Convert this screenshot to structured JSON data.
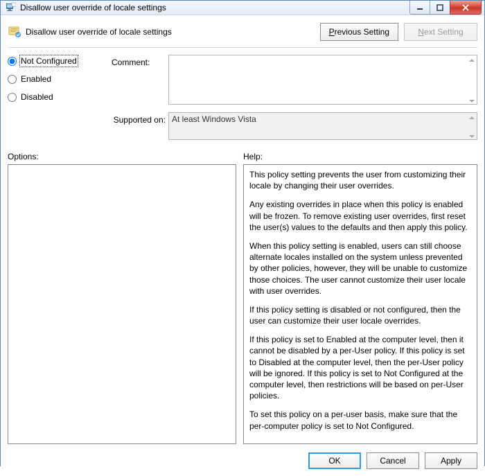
{
  "window": {
    "title": "Disallow user override of locale settings"
  },
  "subheader": {
    "title": "Disallow user override of locale settings",
    "prev_label_pre": "P",
    "prev_label_post": "revious Setting",
    "next_label_pre": "N",
    "next_label_post": "ext Setting"
  },
  "state": {
    "not_configured": "Not Configured",
    "enabled": "Enabled",
    "disabled": "Disabled",
    "selected": "not_configured"
  },
  "fields": {
    "comment_label": "Comment:",
    "comment_value": "",
    "supported_label": "Supported on:",
    "supported_value": "At least Windows Vista"
  },
  "panes": {
    "options_label": "Options:",
    "help_label": "Help:"
  },
  "help": {
    "p1": "This policy setting prevents the user from customizing their locale by changing their user overrides.",
    "p2": "Any existing overrides in place when this policy is enabled will be frozen. To remove existing user overrides, first reset the user(s) values to the defaults and then apply this policy.",
    "p3": "When this policy setting is enabled, users can still choose alternate locales installed on the system unless prevented by other policies, however, they will be unable to customize those choices.  The user cannot customize their user locale with user overrides.",
    "p4": "If this policy setting is disabled or not configured, then the user can customize their user locale overrides.",
    "p5": "If this policy is set to Enabled at the computer level, then it cannot be disabled by a per-User policy. If this policy is set to Disabled at the computer level, then the per-User policy will be ignored. If this policy is set to Not Configured at the computer level, then restrictions will be based on per-User policies.",
    "p6": "To set this policy on a per-user basis, make sure that the per-computer policy is set to Not Configured."
  },
  "buttons": {
    "ok": "OK",
    "cancel": "Cancel",
    "apply": "Apply"
  }
}
